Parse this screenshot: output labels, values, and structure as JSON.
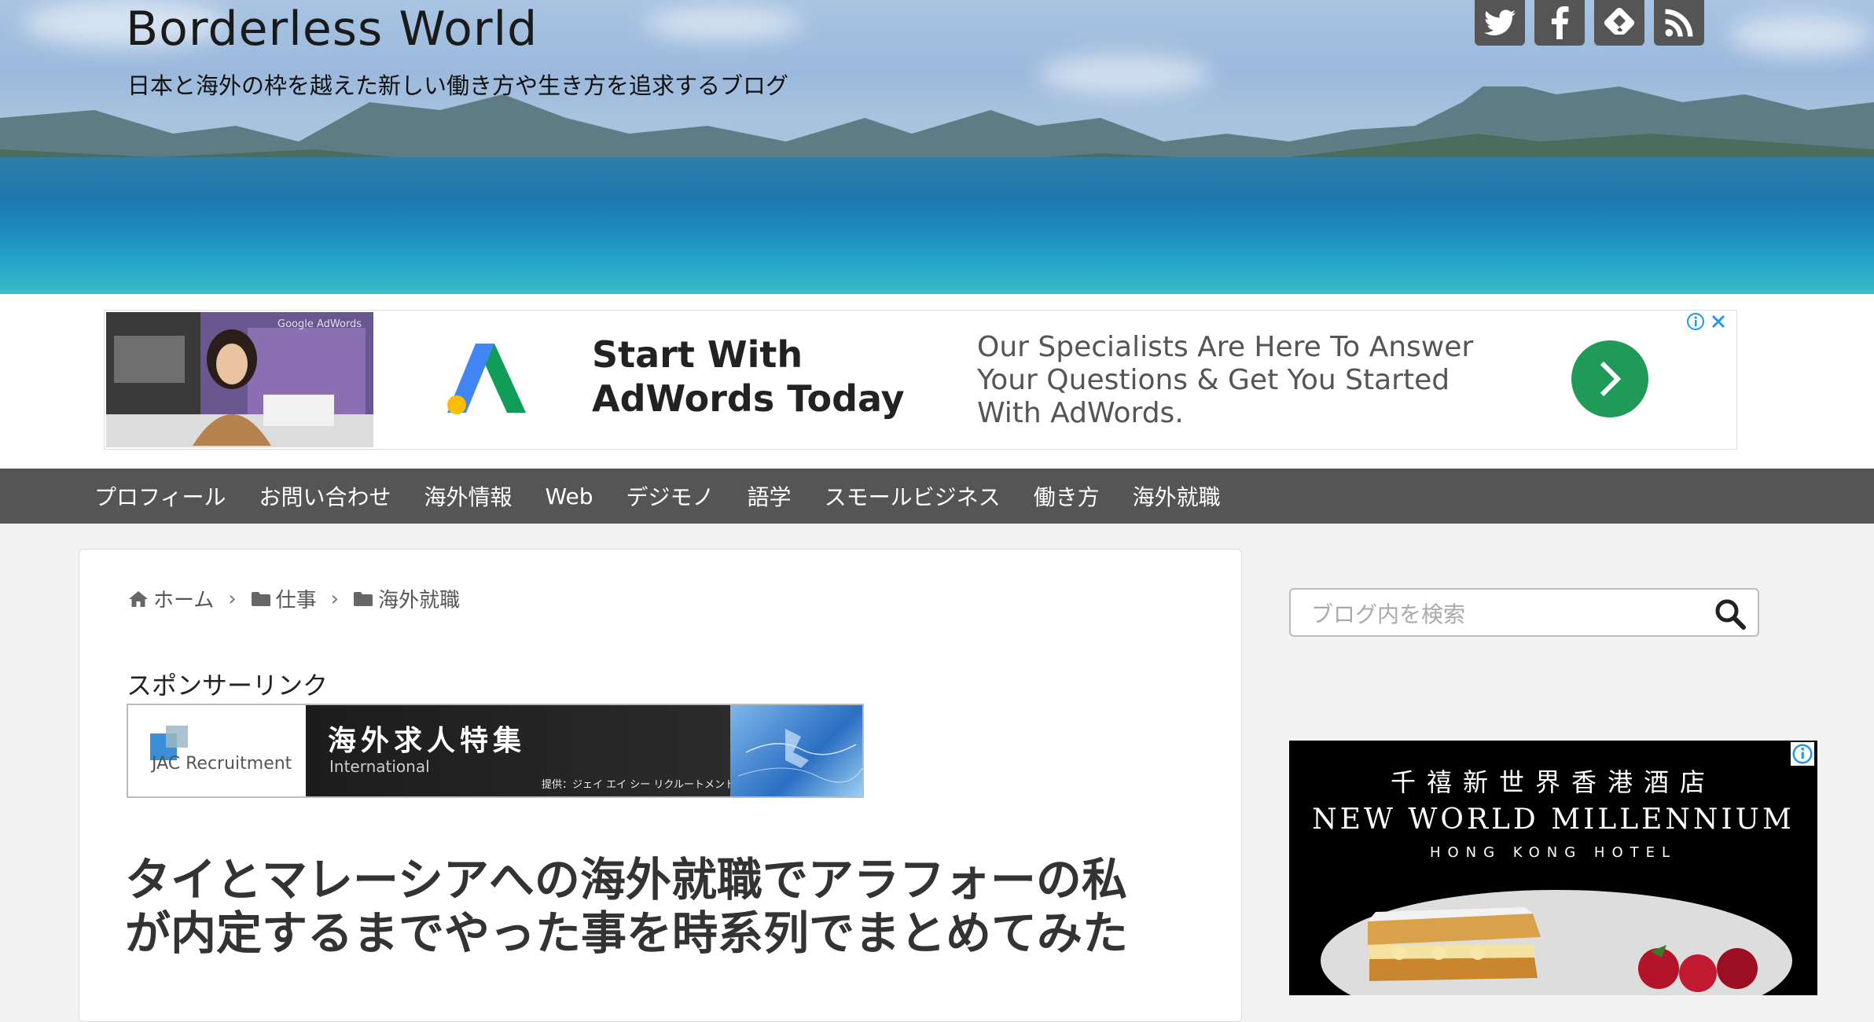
{
  "header": {
    "site_title": "Borderless World",
    "site_description": "日本と海外の枠を越えた新しい働き方や生き方を追求するブログ",
    "social": [
      {
        "icon": "twitter-icon"
      },
      {
        "icon": "facebook-icon"
      },
      {
        "icon": "feedly-icon"
      },
      {
        "icon": "rss-icon"
      }
    ]
  },
  "top_ad": {
    "logo_text": "Google AdWords",
    "headline": "Start With AdWords Today",
    "body": "Our Specialists Are Here To Answer Your Questions & Get You Started With AdWords.",
    "accent": "#1f9b57"
  },
  "nav": {
    "items": [
      "プロフィール",
      "お問い合わせ",
      "海外情報",
      "Web",
      "デジモノ",
      "語学",
      "スモールビジネス",
      "働き方",
      "海外就職"
    ]
  },
  "breadcrumb": {
    "home": "ホーム",
    "level1": "仕事",
    "level2": "海外就職"
  },
  "sponsor": {
    "label": "スポンサーリンク",
    "banner": {
      "brand": "JAC Recruitment",
      "headline": "海外求人特集",
      "sub": "International",
      "provider": "提供：ジェイ エイ シー リクルートメント"
    }
  },
  "article": {
    "title": "タイとマレーシアへの海外就職でアラフォーの私が内定するまでやった事を時系列でまとめてみた"
  },
  "sidebar": {
    "search_placeholder": "ブログ内を検索",
    "ad": {
      "line1": "千禧新世界香港酒店",
      "line2": "NEW WORLD MILLENNIUM",
      "line3": "HONG KONG HOTEL"
    }
  }
}
